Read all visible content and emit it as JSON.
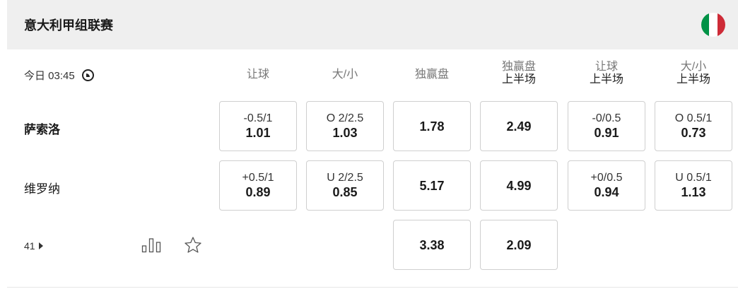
{
  "league": {
    "title": "意大利甲组联赛",
    "flag_colors": [
      "#009246",
      "#ffffff",
      "#ce2b37"
    ],
    "flag_icon": "italy-flag-icon"
  },
  "match": {
    "time": "今日 03:45",
    "home": "萨索洛",
    "away": "维罗纳",
    "more_count": "41"
  },
  "columns": [
    {
      "line1": "让球",
      "line2": ""
    },
    {
      "line1": "大/小",
      "line2": ""
    },
    {
      "line1": "独赢盘",
      "line2": ""
    },
    {
      "line1": "独赢盘",
      "line2": "上半场"
    },
    {
      "line1": "让球",
      "line2": "上半场"
    },
    {
      "line1": "大/小",
      "line2": "上半场"
    }
  ],
  "odds": {
    "home": [
      {
        "line": "-0.5/1",
        "price": "1.01"
      },
      {
        "line": "O 2/2.5",
        "price": "1.03"
      },
      {
        "line": "",
        "price": "1.78"
      },
      {
        "line": "",
        "price": "2.49"
      },
      {
        "line": "-0/0.5",
        "price": "0.91"
      },
      {
        "line": "O 0.5/1",
        "price": "0.73"
      }
    ],
    "away": [
      {
        "line": "+0.5/1",
        "price": "0.89"
      },
      {
        "line": "U 2/2.5",
        "price": "0.85"
      },
      {
        "line": "",
        "price": "5.17"
      },
      {
        "line": "",
        "price": "4.99"
      },
      {
        "line": "+0/0.5",
        "price": "0.94"
      },
      {
        "line": "U 0.5/1",
        "price": "1.13"
      }
    ],
    "draw": [
      {
        "price": "3.38"
      },
      {
        "price": "2.09"
      }
    ]
  }
}
